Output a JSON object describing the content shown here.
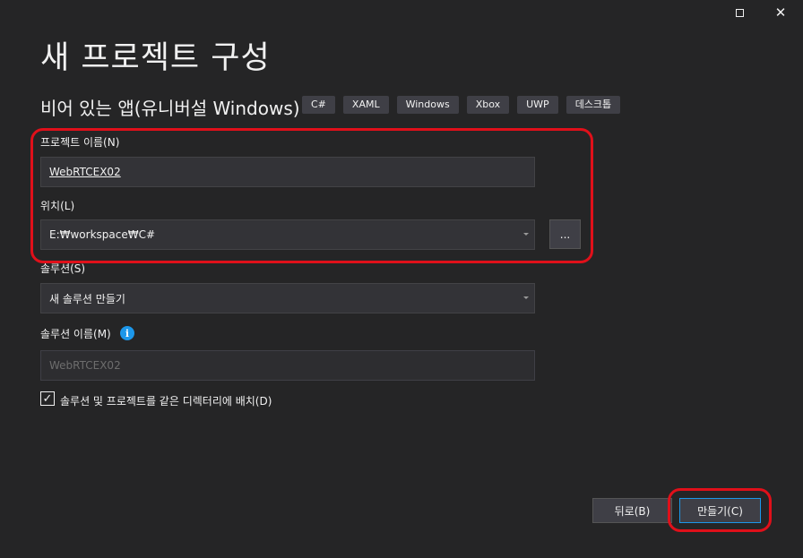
{
  "window": {
    "maximize_icon": "maximize-icon",
    "close_icon": "close-icon",
    "close_glyph": "✕"
  },
  "header": {
    "title": "새 프로젝트 구성",
    "template_name": "비어 있는 앱(유니버설 Windows)",
    "tags": [
      "C#",
      "XAML",
      "Windows",
      "Xbox",
      "UWP",
      "데스크톱"
    ]
  },
  "form": {
    "project_name_label": "프로젝트 이름(N)",
    "project_name_value": "WebRTCEX02",
    "location_label": "위치(L)",
    "location_value": "E:₩workspace₩C#",
    "browse_label": "...",
    "solution_label": "솔루션(S)",
    "solution_value": "새 솔루션 만들기",
    "solution_name_label": "솔루션 이름(M)",
    "solution_name_value": "WebRTCEX02",
    "info_icon": "info-icon",
    "info_glyph": "i",
    "same_dir_label": "솔루션 및 프로젝트를 같은 디렉터리에 배치(D)",
    "same_dir_checked": true,
    "check_glyph": "✓"
  },
  "footer": {
    "back_label": "뒤로(B)",
    "create_label": "만들기(C)"
  },
  "colors": {
    "background": "#252526",
    "accent": "#1c97ea",
    "annotation": "#e0101a"
  }
}
